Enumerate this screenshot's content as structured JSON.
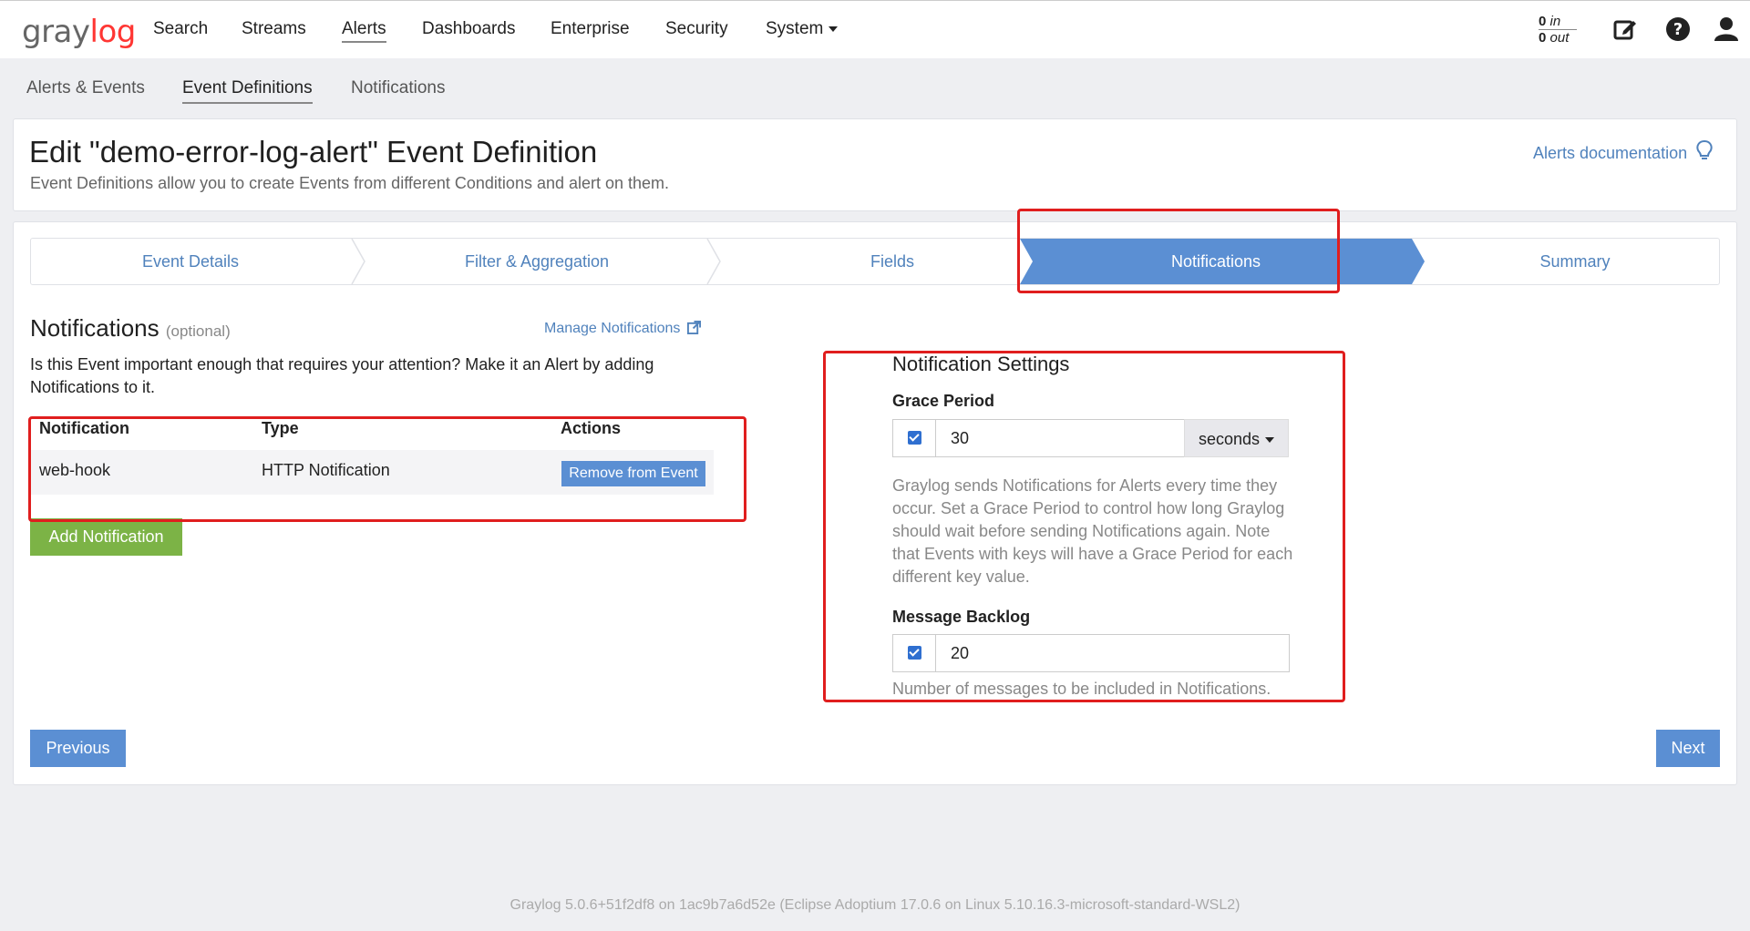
{
  "navbar": {
    "logo_left": "gray",
    "logo_right": "log",
    "items": [
      "Search",
      "Streams",
      "Alerts",
      "Dashboards",
      "Enterprise",
      "Security",
      "System"
    ],
    "throughput_in_value": "0",
    "throughput_in_label": "in",
    "throughput_out_value": "0",
    "throughput_out_label": "out"
  },
  "subnav": {
    "items": [
      "Alerts & Events",
      "Event Definitions",
      "Notifications"
    ]
  },
  "header": {
    "title": "Edit \"demo-error-log-alert\" Event Definition",
    "description": "Event Definitions allow you to create Events from different Conditions and alert on them.",
    "doc_link": "Alerts documentation"
  },
  "wizard": {
    "steps": [
      "Event Details",
      "Filter & Aggregation",
      "Fields",
      "Notifications",
      "Summary"
    ],
    "active_step": "Notifications"
  },
  "notifications": {
    "title": "Notifications",
    "optional": "(optional)",
    "manage_link": "Manage Notifications",
    "description": "Is this Event important enough that requires your attention? Make it an Alert by adding Notifications to it.",
    "columns": [
      "Notification",
      "Type",
      "Actions"
    ],
    "rows": [
      {
        "name": "web-hook",
        "type": "HTTP Notification",
        "action": "Remove from Event"
      }
    ],
    "add_button": "Add Notification"
  },
  "settings": {
    "title": "Notification Settings",
    "grace_period_label": "Grace Period",
    "grace_period_value": "30",
    "grace_period_unit": "seconds",
    "grace_period_help": "Graylog sends Notifications for Alerts every time they occur. Set a Grace Period to control how long Graylog should wait before sending Notifications again. Note that Events with keys will have a Grace Period for each different key value.",
    "backlog_label": "Message Backlog",
    "backlog_value": "20",
    "backlog_help": "Number of messages to be included in Notifications."
  },
  "buttons": {
    "previous": "Previous",
    "next": "Next"
  },
  "footer": {
    "text": "Graylog 5.0.6+51f2df8 on 1ac9b7a6d52e (Eclipse Adoptium 17.0.6 on Linux 5.10.16.3-microsoft-standard-WSL2)"
  },
  "colors": {
    "primary": "#5b8fd3",
    "success": "#7cb346",
    "link": "#5082bc",
    "annotation": "#e01e1e"
  }
}
